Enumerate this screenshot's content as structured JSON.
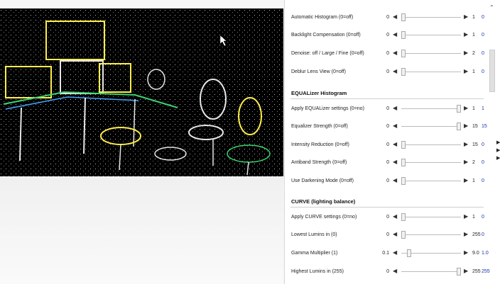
{
  "panel": {
    "rows_top": [
      {
        "label": "Automatic Histogram (0=off)",
        "min": "0",
        "max": "1",
        "value": "0",
        "frac": 0.0
      },
      {
        "label": "Backlight Compensation (0=off)",
        "min": "0",
        "max": "1",
        "value": "0",
        "frac": 0.0
      },
      {
        "label": "Denoise: off / Large / Fine (0=off)",
        "min": "0",
        "max": "2",
        "value": "0",
        "frac": 0.0
      },
      {
        "label": "Deblur Lens View (0=off)",
        "min": "0",
        "max": "1",
        "value": "0",
        "frac": 0.0
      }
    ],
    "sections": [
      {
        "title": "EQUALizer Histogram",
        "rows": [
          {
            "label": "Apply EQUALizer settings (0=no)",
            "min": "0",
            "max": "1",
            "value": "1",
            "frac": 1.0
          },
          {
            "label": "Equalizer Strength (0=off)",
            "min": "0",
            "max": "15",
            "value": "15",
            "frac": 1.0
          },
          {
            "label": "Intensity Reduction (0=off)",
            "min": "0",
            "max": "15",
            "value": "0",
            "frac": 0.0
          },
          {
            "label": "Antiband Strength (0=off)",
            "min": "0",
            "max": "2",
            "value": "0",
            "frac": 0.0
          },
          {
            "label": "Use Darkening Mode (0=off)",
            "min": "0",
            "max": "1",
            "value": "0",
            "frac": 0.0
          }
        ]
      },
      {
        "title": "CURVE (lighting balance)",
        "rows": [
          {
            "label": "Apply CURVE settings (0=no)",
            "min": "0",
            "max": "1",
            "value": "0",
            "frac": 0.0
          },
          {
            "label": "Lowest Lumins in (0)",
            "min": "0",
            "max": "255",
            "value": "0",
            "frac": 0.0
          },
          {
            "label": "Gamma Multiplier (1)",
            "min": "0.1",
            "max": "9.0",
            "value": "1.0",
            "frac": 0.1
          },
          {
            "label": "Highest Lumins in (255)",
            "min": "0",
            "max": "255",
            "value": "255",
            "frac": 1.0
          }
        ]
      }
    ]
  },
  "icons": {
    "slider_left": "◀",
    "slider_right": "▶",
    "scroll_up": "⌃",
    "side_expand": "▶"
  },
  "colors": {
    "current_value": "#1a2fb0",
    "preview_bg": "#000000"
  }
}
